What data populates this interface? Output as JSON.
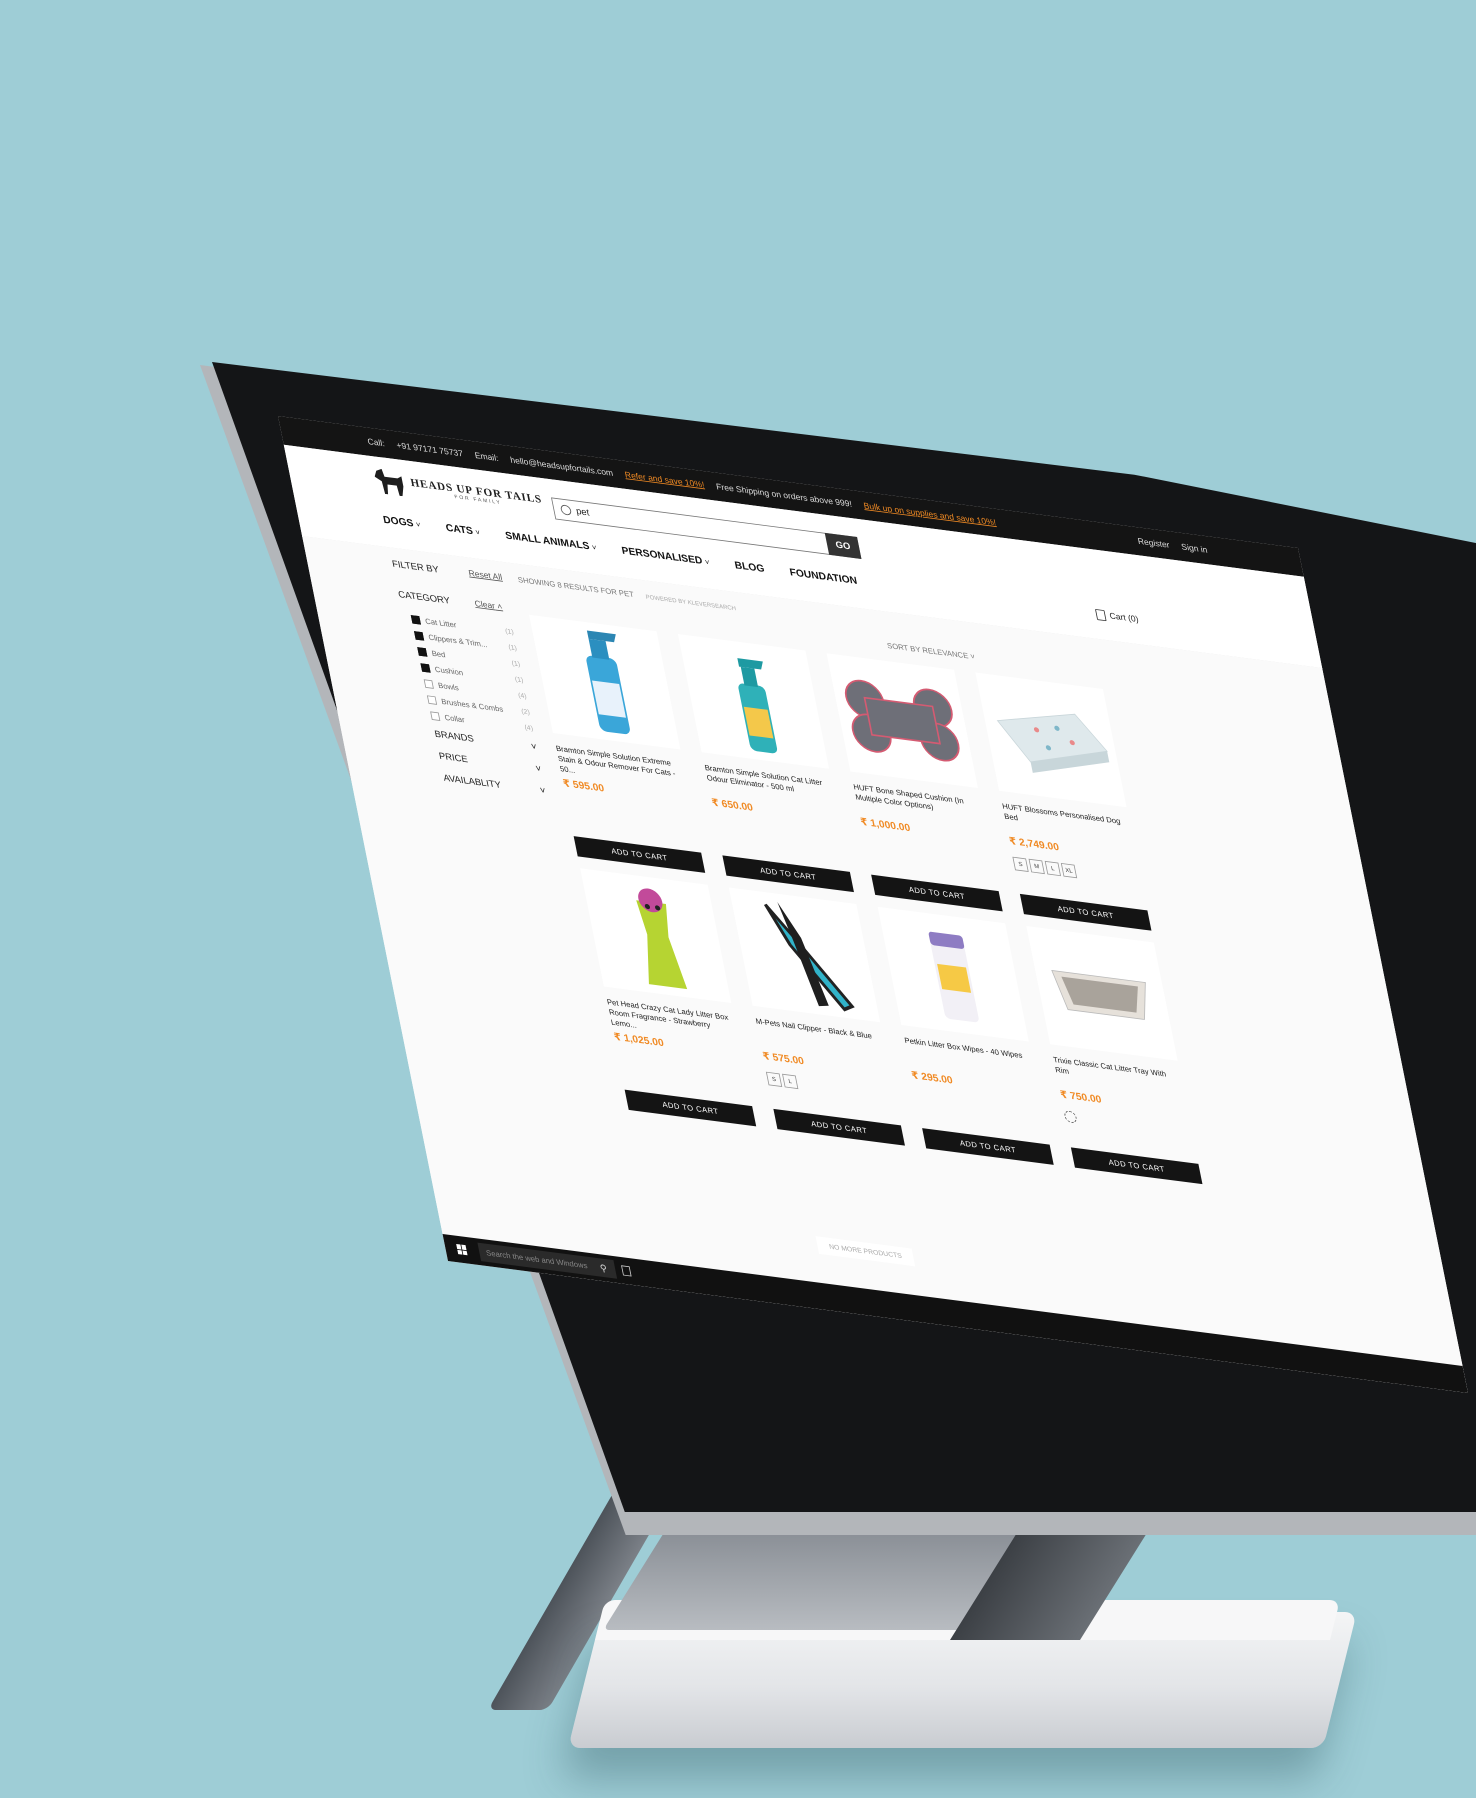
{
  "topbar": {
    "call_label": "Call:",
    "call_number": "+91 97171 75737",
    "email_label": "Email:",
    "email_value": "hello@headsupfortails.com",
    "promo1": "Refer and save 10%!",
    "shipping": "Free Shipping on orders above 999!",
    "promo2": "Bulk up on supplies and save 10%!",
    "register": "Register",
    "signin": "Sign in"
  },
  "logo": {
    "name": "HEADS UP FOR TAILS",
    "tagline": "FOR FAMILY"
  },
  "search": {
    "value": "pet",
    "go_label": "GO"
  },
  "nav": [
    {
      "label": "DOGS",
      "chev": "˅"
    },
    {
      "label": "CATS",
      "chev": "˅"
    },
    {
      "label": "SMALL ANIMALS",
      "chev": "˅"
    },
    {
      "label": "PERSONALISED",
      "chev": "˅"
    },
    {
      "label": "BLOG",
      "chev": ""
    },
    {
      "label": "FOUNDATION",
      "chev": ""
    }
  ],
  "cart": {
    "label": "Cart (0)"
  },
  "filters": {
    "filter_by": "FILTER BY",
    "reset_all": "Reset All",
    "category": "CATEGORY",
    "clear": "Clear",
    "items": [
      {
        "label": "Cat Litter",
        "count": "(1)",
        "checked": true
      },
      {
        "label": "Clippers & Trim...",
        "count": "(1)",
        "checked": true
      },
      {
        "label": "Bed",
        "count": "(1)",
        "checked": true
      },
      {
        "label": "Cushion",
        "count": "(1)",
        "checked": true
      },
      {
        "label": "Bowls",
        "count": "(4)",
        "checked": false
      },
      {
        "label": "Brushes & Combs",
        "count": "(2)",
        "checked": false
      },
      {
        "label": "Collar",
        "count": "(4)",
        "checked": false
      }
    ],
    "brands": "BRANDS",
    "price": "PRICE",
    "availability": "AVAILABLITY"
  },
  "results": {
    "showing": "SHOWING 8 RESULTS FOR PET",
    "powered": "POWERED BY KLEVERSEARCH",
    "sort": "SORT BY RELEVANCE"
  },
  "products": [
    {
      "name": "Bramton Simple Solution Extreme Stain & Odour Remover For Cats - 50...",
      "price": "₹ 595.00",
      "image": "spray-bottle-blue",
      "sizes": []
    },
    {
      "name": "Bramton Simple Solution Cat Litter Odour Eliminator - 500 ml",
      "price": "₹ 650.00",
      "image": "spray-bottle-teal",
      "sizes": []
    },
    {
      "name": "HUFT Bone Shaped Cushion (In Multiple Color Options)",
      "price": "₹ 1,000.00",
      "image": "bone-cushion",
      "sizes": []
    },
    {
      "name": "HUFT Blossoms Personalised Dog Bed",
      "price": "₹ 2,749.00",
      "image": "floral-dog-bed",
      "sizes": [
        "S",
        "M",
        "L",
        "XL"
      ]
    },
    {
      "name": "Pet Head Crazy Cat Lady Litter Box Room Fragrance - Strawberry Lemo...",
      "price": "₹ 1,025.00",
      "image": "crazy-cat-lady-bottle",
      "sizes": []
    },
    {
      "name": "M-Pets Nail Clipper - Black & Blue",
      "price": "₹ 575.00",
      "image": "nail-clipper",
      "sizes": [
        "S",
        "L"
      ]
    },
    {
      "name": "Petkin Litter Box Wipes - 40 Wipes",
      "price": "₹ 295.00",
      "image": "litter-box-wipes",
      "sizes": []
    },
    {
      "name": "Trixie Classic Cat Litter Tray With Rim",
      "price": "₹ 750.00",
      "image": "litter-tray",
      "sizes": [],
      "swatch": true
    }
  ],
  "add_to_cart": "ADD TO CART",
  "no_more": "NO MORE PRODUCTS",
  "taskbar": {
    "search_placeholder": "Search the web and Windows"
  }
}
